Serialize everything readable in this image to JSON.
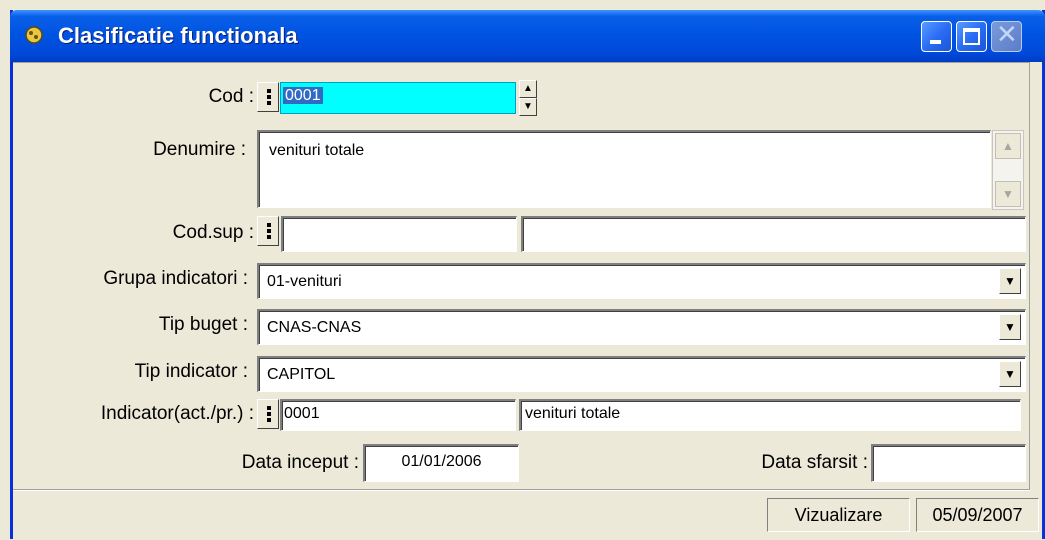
{
  "window": {
    "title": "Clasificatie functionala",
    "controls": {
      "minimize": "minimize-icon",
      "maximize": "maximize-icon",
      "close": "close-icon"
    }
  },
  "form": {
    "cod": {
      "label": "Cod :",
      "value": "0001"
    },
    "denumire": {
      "label": "Denumire :",
      "value": "venituri totale"
    },
    "cod_sup": {
      "label": "Cod.sup :",
      "value": "",
      "description": ""
    },
    "grupa_indicatori": {
      "label": "Grupa indicatori :",
      "value": "01-venituri"
    },
    "tip_buget": {
      "label": "Tip buget :",
      "value": "CNAS-CNAS"
    },
    "tip_indicator": {
      "label": "Tip indicator :",
      "value": "CAPITOL"
    },
    "indicator": {
      "label": "Indicator(act./pr.) :",
      "value": "0001",
      "description": "venituri totale"
    },
    "data_inceput": {
      "label": "Data inceput :",
      "value": "01/01/2006"
    },
    "data_sfarsit": {
      "label": "Data sfarsit :",
      "value": ""
    }
  },
  "status_bar": {
    "mode": "Vizualizare",
    "date": "05/09/2007"
  },
  "colors": {
    "titlebar": "#0054e3",
    "selected_field": "#00ffff",
    "face": "#ece9d8"
  }
}
